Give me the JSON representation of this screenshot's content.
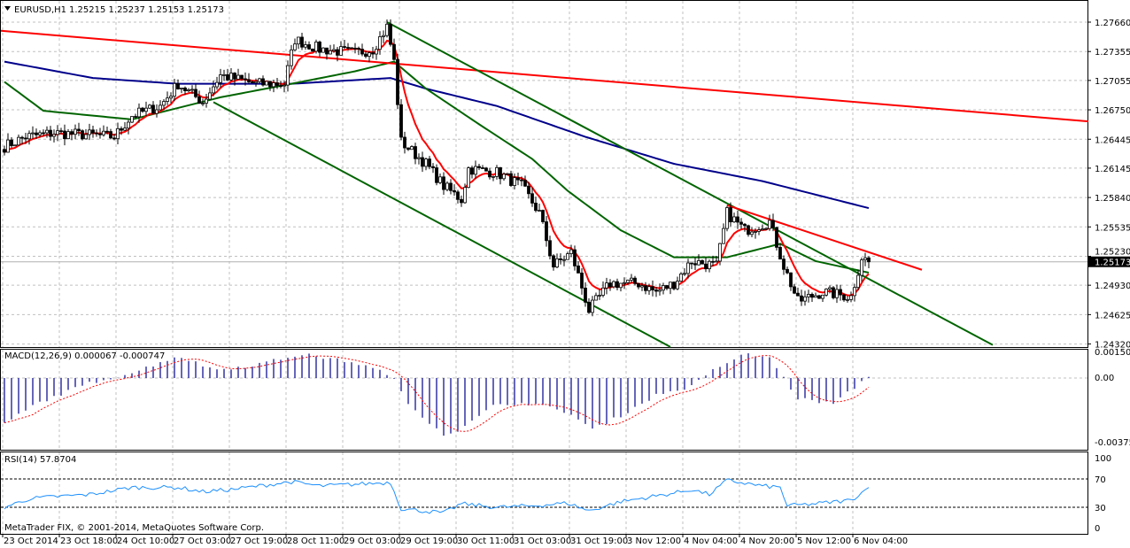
{
  "header": {
    "symbol": "EURUSD,H1",
    "ohlc": "1.25215 1.25237 1.25153 1.25173"
  },
  "copyright": "MetaTrader FIX, © 2001-2014, MetaQuotes Software Corp.",
  "colors": {
    "bull_body": "#ffffff",
    "bear_body": "#000000",
    "ma_fast": "#ff0000",
    "ma_mid": "#006400",
    "ma_slow": "#00008b",
    "trend_red": "#ff0000",
    "trend_green": "#006400",
    "macd_hist": "#00008b",
    "macd_signal": "#ff0000",
    "rsi": "#1e90ff",
    "grid": "#c0c0c0"
  },
  "chart_data": {
    "type": "candlestick",
    "symbol": "EURUSD",
    "timeframe": "H1",
    "current_price": 1.25173,
    "price_axis": [
      "1.27660",
      "1.27355",
      "1.27055",
      "1.26750",
      "1.26445",
      "1.26145",
      "1.25840",
      "1.25535",
      "1.25230",
      "1.24930",
      "1.24625",
      "1.24320"
    ],
    "ylim": [
      1.2432,
      1.2766
    ],
    "time_axis": [
      "23 Oct 2014",
      "23 Oct 18:00",
      "24 Oct 10:00",
      "27 Oct 03:00",
      "27 Oct 19:00",
      "28 Oct 11:00",
      "29 Oct 03:00",
      "29 Oct 19:00",
      "30 Oct 11:00",
      "31 Oct 03:00",
      "31 Oct 19:00",
      "3 Nov 12:00",
      "4 Nov 04:00",
      "4 Nov 20:00",
      "5 Nov 12:00",
      "6 Nov 04:00"
    ],
    "bars_between_time_labels": 16,
    "bar_count": 245,
    "close_keypoints": [
      [
        0,
        1.2637
      ],
      [
        6,
        1.2647
      ],
      [
        14,
        1.2651
      ],
      [
        24,
        1.2649
      ],
      [
        31,
        1.2647
      ],
      [
        36,
        1.2669
      ],
      [
        44,
        1.2679
      ],
      [
        49,
        1.2702
      ],
      [
        56,
        1.2683
      ],
      [
        61,
        1.2711
      ],
      [
        71,
        1.2702
      ],
      [
        79,
        1.2702
      ],
      [
        82,
        1.2748
      ],
      [
        89,
        1.2738
      ],
      [
        99,
        1.2734
      ],
      [
        104,
        1.2738
      ],
      [
        108,
        1.2761
      ],
      [
        110,
        1.2725
      ],
      [
        112,
        1.2642
      ],
      [
        119,
        1.2619
      ],
      [
        124,
        1.2596
      ],
      [
        129,
        1.2582
      ],
      [
        131,
        1.2614
      ],
      [
        139,
        1.261
      ],
      [
        146,
        1.2596
      ],
      [
        151,
        1.2568
      ],
      [
        155,
        1.2513
      ],
      [
        160,
        1.2527
      ],
      [
        165,
        1.2467
      ],
      [
        171,
        1.2495
      ],
      [
        179,
        1.2495
      ],
      [
        184,
        1.2486
      ],
      [
        189,
        1.2495
      ],
      [
        194,
        1.2518
      ],
      [
        201,
        1.2513
      ],
      [
        204,
        1.2568
      ],
      [
        209,
        1.255
      ],
      [
        216,
        1.2559
      ],
      [
        220,
        1.2513
      ],
      [
        224,
        1.2476
      ],
      [
        231,
        1.2486
      ],
      [
        239,
        1.2481
      ],
      [
        242,
        1.2522
      ],
      [
        244,
        1.25173
      ]
    ],
    "ma_slow_keypoints": [
      [
        0,
        1.2725
      ],
      [
        25,
        1.2708
      ],
      [
        49,
        1.2702
      ],
      [
        81,
        1.2702
      ],
      [
        109,
        1.2708
      ],
      [
        119,
        1.2697
      ],
      [
        139,
        1.2679
      ],
      [
        164,
        1.2647
      ],
      [
        189,
        1.2619
      ],
      [
        214,
        1.2601
      ],
      [
        244,
        1.2573
      ]
    ],
    "ma_mid_keypoints": [
      [
        0,
        1.2704
      ],
      [
        11,
        1.2674
      ],
      [
        36,
        1.2665
      ],
      [
        61,
        1.2688
      ],
      [
        81,
        1.2702
      ],
      [
        99,
        1.2715
      ],
      [
        110,
        1.2725
      ],
      [
        119,
        1.2697
      ],
      [
        134,
        1.266
      ],
      [
        149,
        1.2624
      ],
      [
        159,
        1.2591
      ],
      [
        174,
        1.255
      ],
      [
        189,
        1.2522
      ],
      [
        204,
        1.2522
      ],
      [
        219,
        1.2536
      ],
      [
        229,
        1.2518
      ],
      [
        244,
        1.2506
      ]
    ],
    "trendlines": [
      {
        "color": "red",
        "from": [
          -1,
          1.2757
        ],
        "to": [
          306,
          1.2663
        ]
      },
      {
        "color": "green",
        "from": [
          108,
          1.2766
        ],
        "to": [
          279,
          1.2431
        ]
      },
      {
        "color": "green",
        "from": [
          59,
          1.2683
        ],
        "to": [
          188,
          1.2429
        ]
      },
      {
        "color": "red",
        "from": [
          204,
          1.2576
        ],
        "to": [
          259,
          1.2509
        ]
      }
    ],
    "macd": {
      "label": "MACD(12,26,9) 0.000067 -0.000747",
      "axis": [
        "0.001501",
        "0.00",
        "-0.003752"
      ],
      "ylim": [
        -0.003752,
        0.001501
      ],
      "keypoints": [
        [
          0,
          -0.0027
        ],
        [
          9,
          -0.0015
        ],
        [
          24,
          -0.0003
        ],
        [
          36,
          0.0003
        ],
        [
          49,
          0.0013
        ],
        [
          59,
          0.0005
        ],
        [
          69,
          0.0007
        ],
        [
          84,
          0.0014
        ],
        [
          99,
          0.0009
        ],
        [
          109,
          0.0002
        ],
        [
          114,
          -0.0015
        ],
        [
          124,
          -0.0033
        ],
        [
          129,
          -0.003
        ],
        [
          139,
          -0.0015
        ],
        [
          149,
          -0.0015
        ],
        [
          159,
          -0.002
        ],
        [
          166,
          -0.003
        ],
        [
          174,
          -0.0022
        ],
        [
          184,
          -0.001
        ],
        [
          194,
          -0.0005
        ],
        [
          201,
          0.0006
        ],
        [
          209,
          0.0014
        ],
        [
          216,
          0.0012
        ],
        [
          224,
          -0.0012
        ],
        [
          234,
          -0.0015
        ],
        [
          244,
          6.7e-05
        ]
      ]
    },
    "rsi": {
      "label": "RSI(14) 57.8704",
      "axis": [
        "100",
        "70",
        "30",
        "0"
      ],
      "levels": [
        70,
        30
      ],
      "keypoints": [
        [
          0,
          30
        ],
        [
          7,
          42
        ],
        [
          14,
          45
        ],
        [
          24,
          48
        ],
        [
          36,
          58
        ],
        [
          49,
          58
        ],
        [
          56,
          52
        ],
        [
          64,
          55
        ],
        [
          81,
          66
        ],
        [
          89,
          60
        ],
        [
          109,
          65
        ],
        [
          112,
          28
        ],
        [
          124,
          22
        ],
        [
          129,
          35
        ],
        [
          139,
          30
        ],
        [
          149,
          32
        ],
        [
          159,
          36
        ],
        [
          165,
          25
        ],
        [
          174,
          38
        ],
        [
          189,
          50
        ],
        [
          194,
          55
        ],
        [
          199,
          48
        ],
        [
          204,
          68
        ],
        [
          214,
          60
        ],
        [
          219,
          58
        ],
        [
          221,
          32
        ],
        [
          229,
          35
        ],
        [
          239,
          40
        ],
        [
          244,
          57.87
        ]
      ]
    }
  }
}
